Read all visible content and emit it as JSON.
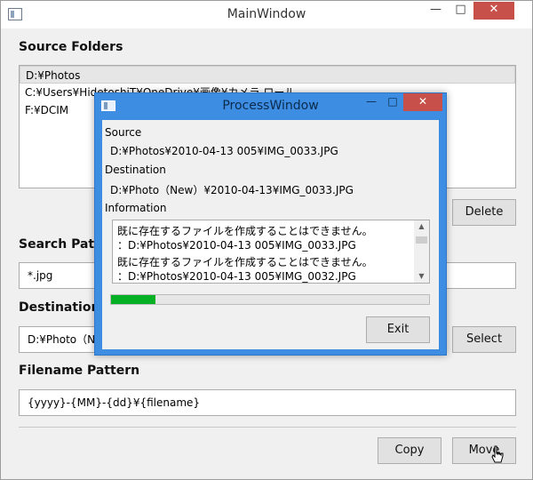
{
  "main_window": {
    "title": "MainWindow",
    "controls": {
      "minimize": "—",
      "maximize": "□",
      "close": "✕"
    },
    "source_folders": {
      "label": "Source Folders",
      "items": [
        "D:¥Photos",
        "C:¥Users¥HidetoshiT¥OneDrive¥画像¥カメラ ロール",
        "F:¥DCIM"
      ]
    },
    "delete_button": "Delete",
    "search_pattern": {
      "label": "Search Patt",
      "value": "*.jpg"
    },
    "destination": {
      "label": "Destination",
      "value": "D:¥Photo（N"
    },
    "select_button": "Select",
    "filename_pattern": {
      "label": "Filename Pattern",
      "value": "{yyyy}-{MM}-{dd}¥{filename}"
    },
    "copy_button": "Copy",
    "move_button": "Move"
  },
  "process_window": {
    "title": "ProcessWindow",
    "controls": {
      "minimize": "—",
      "maximize": "□",
      "close": "✕"
    },
    "source_label": "Source",
    "source_value": "D:¥Photos¥2010-04-13 005¥IMG_0033.JPG",
    "destination_label": "Destination",
    "destination_value": "D:¥Photo（New）¥2010-04-13¥IMG_0033.JPG",
    "information_label": "Information",
    "information_lines": [
      "既に存在するファイルを作成することはできません。",
      "：D:¥Photos¥2010-04-13 005¥IMG_0033.JPG",
      "既に存在するファイルを作成することはできません。",
      "：D:¥Photos¥2010-04-13 005¥IMG_0032.JPG"
    ],
    "scroll_up": "▲",
    "scroll_down": "▼",
    "progress_fraction": 0.14,
    "progress_color": "#06b025",
    "exit_button": "Exit"
  },
  "colors": {
    "titlebar_active": "#3d8ee3",
    "close_button": "#c7504a",
    "window_bg": "#f0f0f0"
  }
}
